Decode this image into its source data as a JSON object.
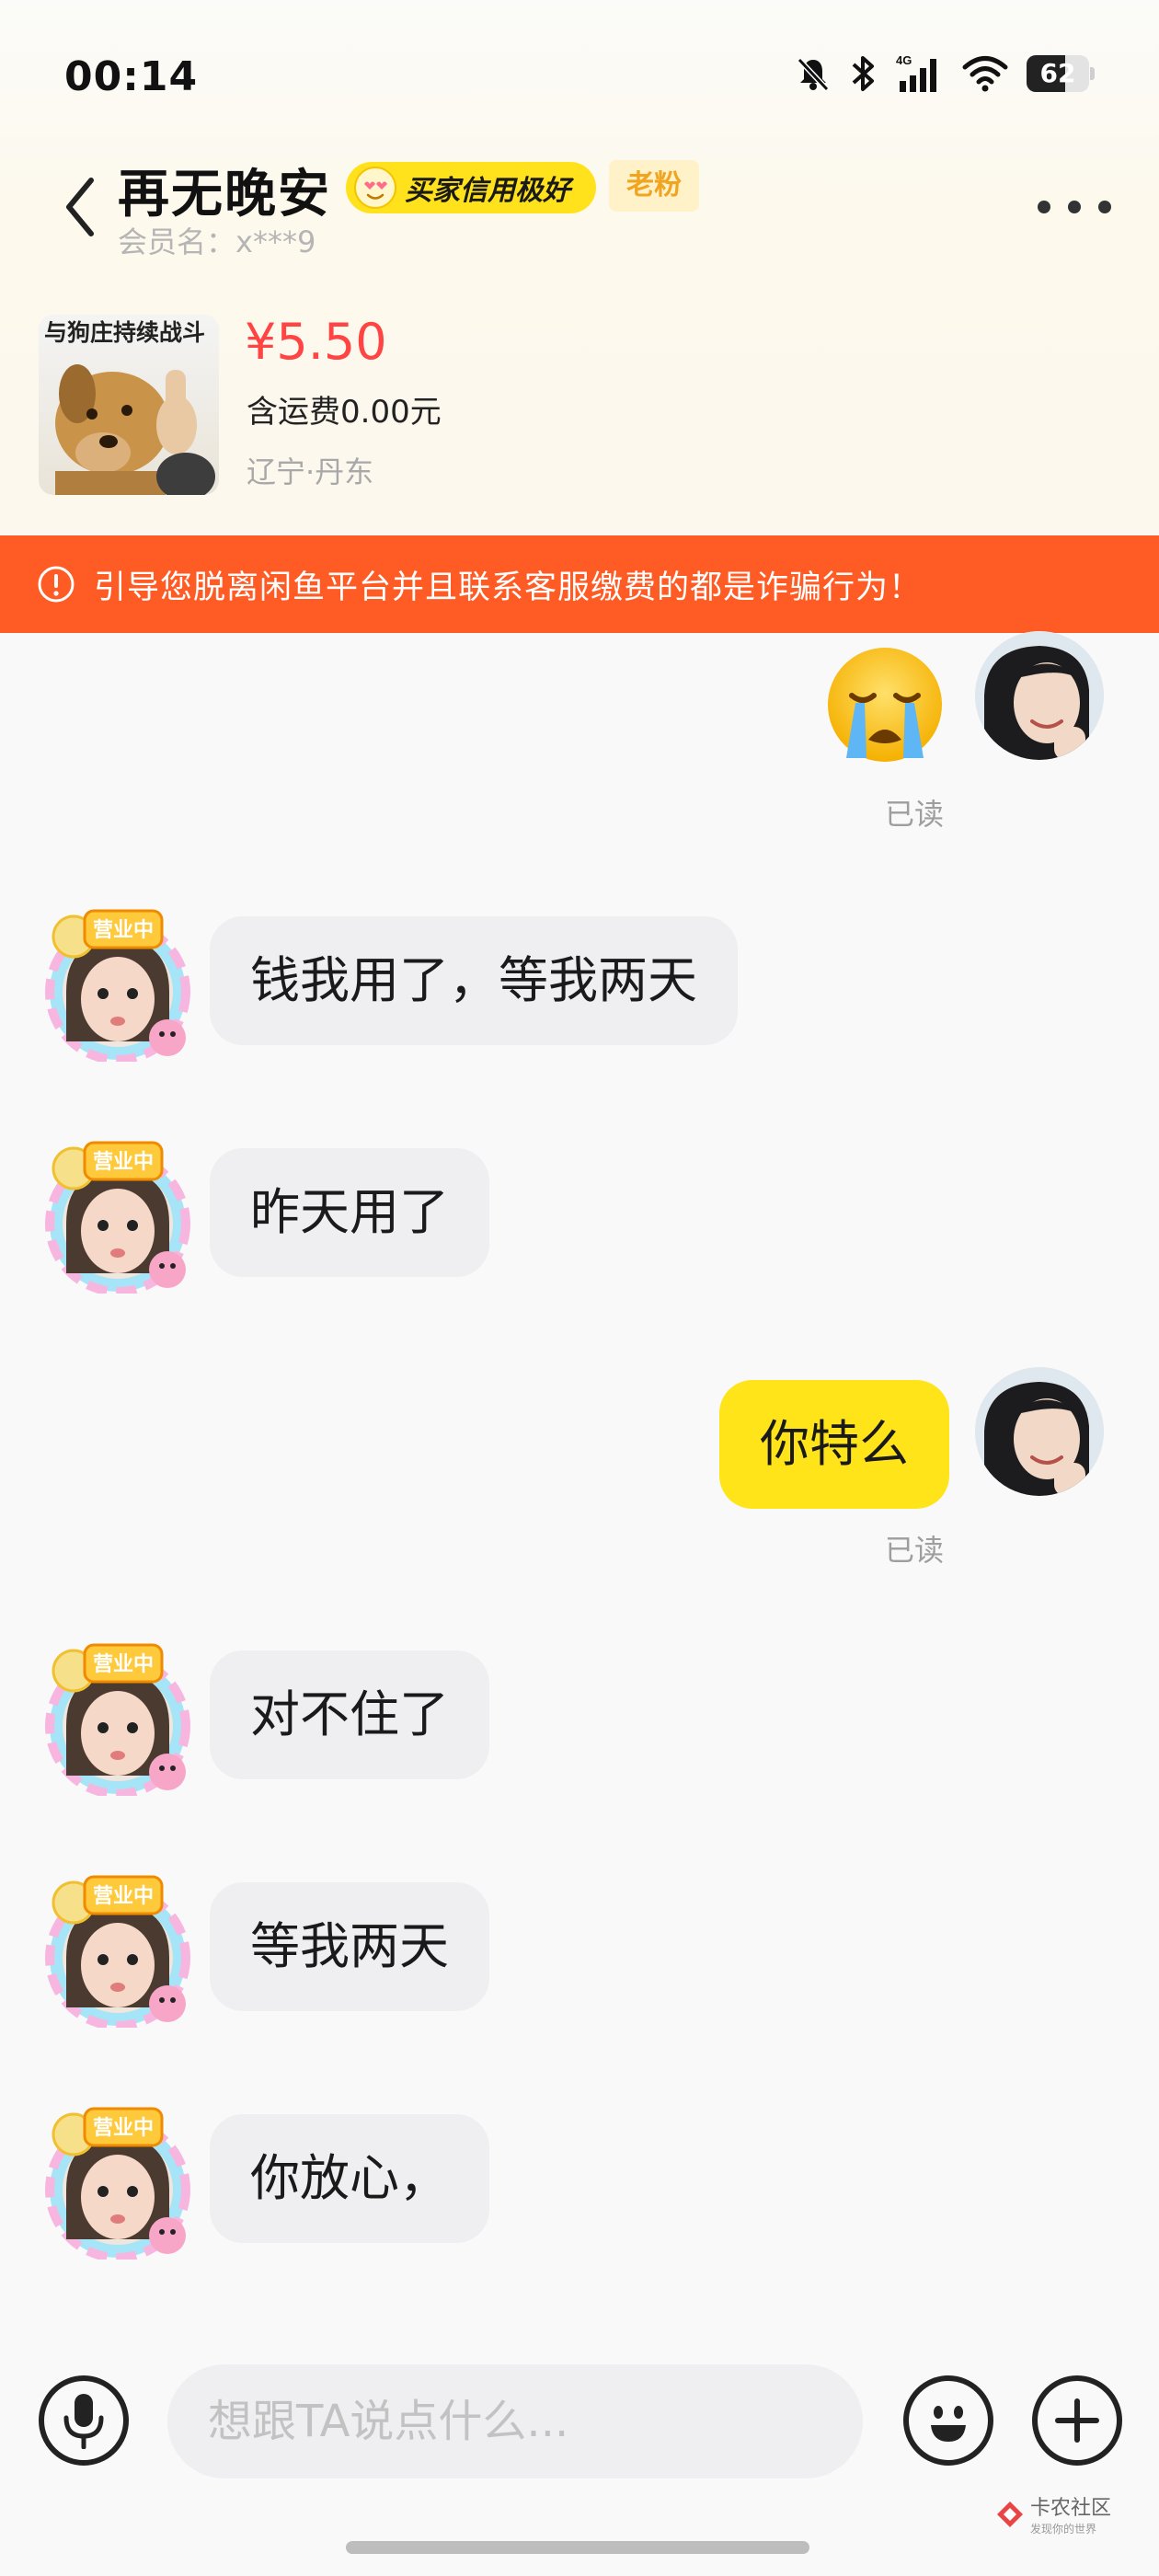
{
  "status_bar": {
    "time": "00:14",
    "battery": "62",
    "network": "4G"
  },
  "header": {
    "nickname": "再无晚安",
    "credit_badge": "买家信用极好",
    "fan_tag": "老粉",
    "member_label": "会员名：",
    "member_name": "x***9"
  },
  "product": {
    "thumb_caption": "与狗庄持续战斗",
    "price": "¥5.50",
    "shipping": "含运费0.00元",
    "location": "辽宁·丹东"
  },
  "warning": {
    "text": "引导您脱离闲鱼平台并且联系客服缴费的都是诈骗行为！"
  },
  "messages": [
    {
      "from": "me",
      "type": "emoji",
      "emoji": "crying-face",
      "read": "已读"
    },
    {
      "from": "other",
      "type": "text",
      "text": "钱我用了，等我两天",
      "badge": "营业中"
    },
    {
      "from": "other",
      "type": "text",
      "text": "昨天用了",
      "badge": "营业中"
    },
    {
      "from": "me",
      "type": "text",
      "text": "你特么",
      "read": "已读"
    },
    {
      "from": "other",
      "type": "text",
      "text": "对不住了",
      "badge": "营业中"
    },
    {
      "from": "other",
      "type": "text",
      "text": "等我两天",
      "badge": "营业中"
    },
    {
      "from": "other",
      "type": "text",
      "text": "你放心，",
      "badge": "营业中"
    }
  ],
  "input": {
    "placeholder": "想跟TA说点什么..."
  },
  "watermark": {
    "title": "卡农社区",
    "subtitle": "发现你的世界"
  },
  "colors": {
    "accent_yellow": "#ffe41a",
    "warning_orange": "#ff5b24",
    "price_red": "#ff4444"
  },
  "icons": [
    "back-icon",
    "more-icon",
    "mic-icon",
    "emoji-icon",
    "plus-icon",
    "warning-icon"
  ]
}
